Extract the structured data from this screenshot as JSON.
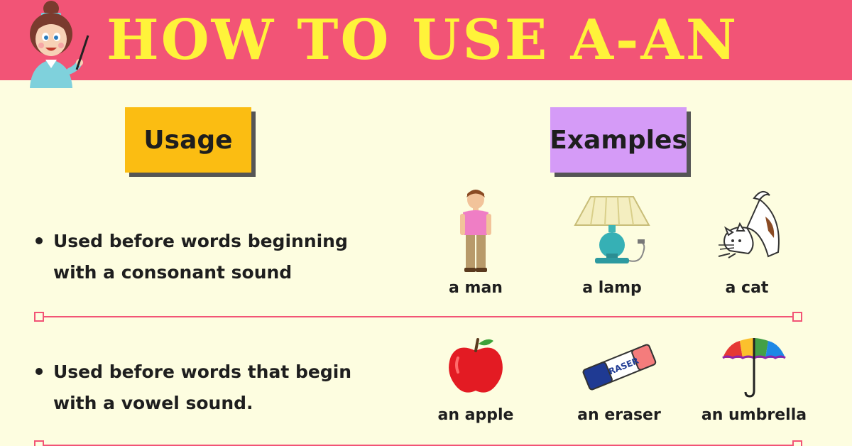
{
  "banner": {
    "title": "HOW TO USE A-AN",
    "background_color": "#f25476",
    "title_color": "#fff33a"
  },
  "headers": {
    "usage": "Usage",
    "examples": "Examples",
    "usage_color": "#fbbd12",
    "examples_color": "#d59bf7"
  },
  "rows": [
    {
      "rule": "Used before words beginning with a consonant sound",
      "rule_lines": [
        "Used before words beginning",
        "with a consonant sound"
      ],
      "examples": [
        {
          "label": "a man",
          "icon": "man-icon"
        },
        {
          "label": "a lamp",
          "icon": "lamp-icon"
        },
        {
          "label": "a cat",
          "icon": "cat-icon"
        }
      ]
    },
    {
      "rule": "Used before words that begin with a vowel sound.",
      "rule_lines": [
        "Used before words that begin",
        "with a vowel sound."
      ],
      "examples": [
        {
          "label": "an apple",
          "icon": "apple-icon"
        },
        {
          "label": "an eraser",
          "icon": "eraser-icon",
          "icon_text": "ERASER"
        },
        {
          "label": "an umbrella",
          "icon": "umbrella-icon"
        }
      ]
    }
  ]
}
